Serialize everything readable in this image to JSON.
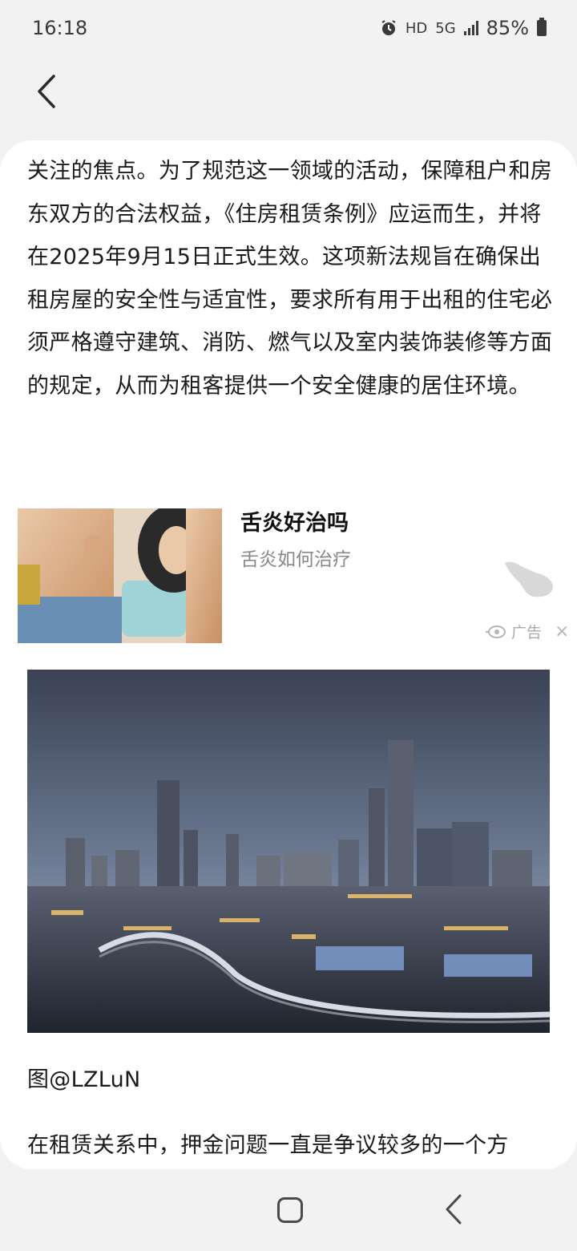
{
  "status_bar": {
    "time": "16:18",
    "hd": "HD",
    "network": "5G",
    "battery": "85%",
    "icons": [
      "alarm-icon",
      "signal-icon",
      "battery-icon"
    ]
  },
  "nav": {
    "back_icon": "chevron-left-icon"
  },
  "article": {
    "paragraph_top": "关注的焦点。为了规范这一领域的活动，保障租户和房东双方的合法权益，《住房租赁条例》应运而生，并将在2025年9月15日正式生效。这项新法规旨在确保出租房屋的安全性与适宜性，要求所有用于出租的住宅必须严格遵守建筑、消防、燃气以及室内装饰装修等方面的规定，从而为租客提供一个安全健康的居住环境。",
    "image_caption": "图@LZLuN",
    "paragraph_bottom": "在租赁关系中，押金问题一直是争议较多的一个方"
  },
  "ad": {
    "title": "舌炎好治吗",
    "subtitle": "舌炎如何治疗",
    "label": "广告",
    "close": "×"
  },
  "colors": {
    "background": "#f2f2f2",
    "card": "#ffffff",
    "text": "#1a1a1a",
    "muted": "#888888"
  }
}
